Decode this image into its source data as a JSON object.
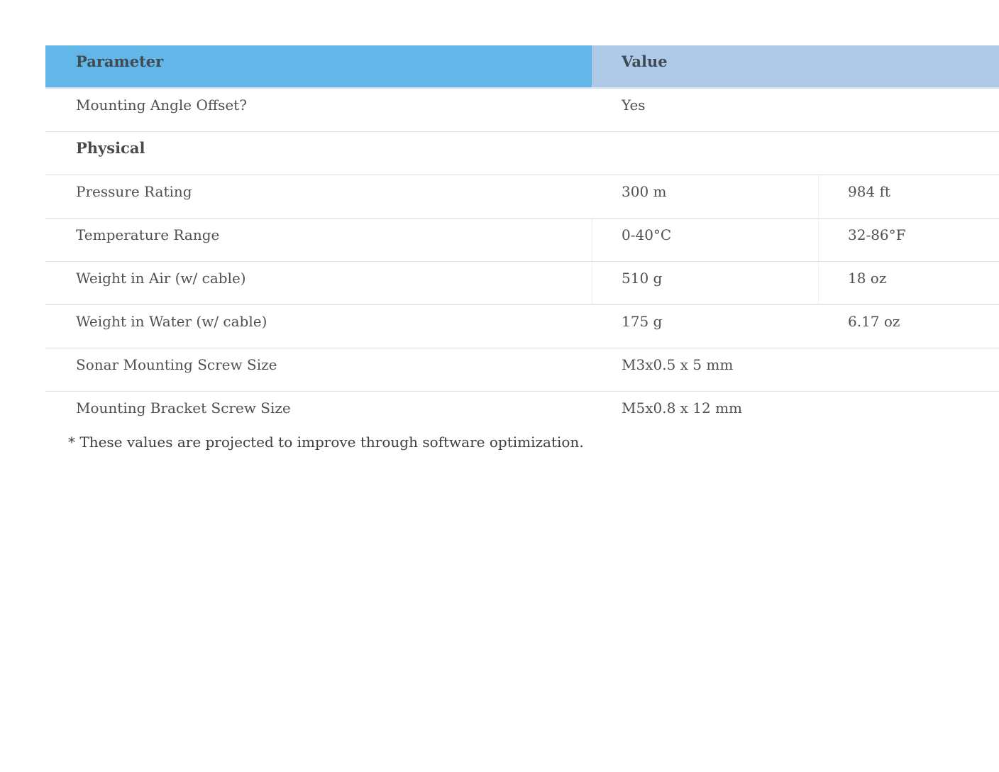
{
  "table": {
    "headers": {
      "parameter": "Parameter",
      "value": "Value"
    },
    "rows": [
      {
        "label": "Mounting Angle Offset?",
        "value": "Yes",
        "alt": ""
      },
      {
        "section": "Physical"
      },
      {
        "label": "Pressure Rating",
        "value": "300 m",
        "alt": "984 ft"
      },
      {
        "label": "Temperature Range",
        "value": "0-40°C",
        "alt": "32-86°F"
      },
      {
        "label": "Weight in Air (w/ cable)",
        "value": "510 g",
        "alt": "18 oz"
      },
      {
        "label": "Weight in Water (w/ cable)",
        "value": "175 g",
        "alt": "6.17 oz"
      },
      {
        "label": "Sonar Mounting Screw Size",
        "value": "M3x0.5 x 5 mm",
        "alt": ""
      },
      {
        "label": "Mounting Bracket Screw Size",
        "value": "M5x0.8 x 12 mm",
        "alt": ""
      }
    ]
  },
  "footnote": "* These values are projected to improve through software optimization.",
  "colors": {
    "header_param_bg": "#62b7e8",
    "header_value_bg": "#aecae8"
  }
}
